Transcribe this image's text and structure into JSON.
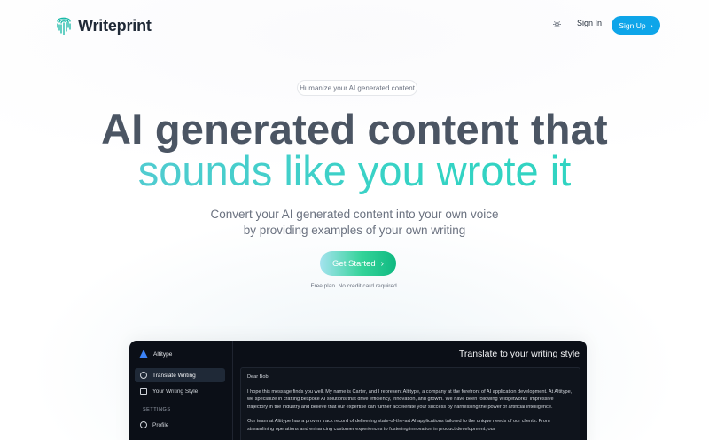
{
  "brand": {
    "name": "Writeprint"
  },
  "nav": {
    "signin_label": "Sign In",
    "signup_label": "Sign Up",
    "theme_icon": "sun-icon"
  },
  "hero": {
    "pill": "Humanize your AI generated content",
    "headline_line1": "AI generated content that",
    "headline_line2": "sounds like you wrote it",
    "subtitle_line1": "Convert your AI generated content into your own voice",
    "subtitle_line2": "by providing examples of your own writing",
    "cta_label": "Get Started",
    "note": "Free plan. No credit card required."
  },
  "app": {
    "brand": "Altitype",
    "nav_items": [
      {
        "label": "Translate Writing",
        "icon": "plus-circle-icon",
        "active": true
      },
      {
        "label": "Your Writing Style",
        "icon": "edit-icon",
        "active": false
      }
    ],
    "settings_label": "SETTINGS",
    "settings_items": [
      {
        "label": "Profile",
        "icon": "user-icon"
      }
    ],
    "title": "Translate to your writing style",
    "letter": {
      "greeting": "Dear Bob,",
      "para1": "I hope this message finds you well. My name is Carter, and I represent Altitype, a company at the forefront of AI application development. At Altitype, we specialize in crafting bespoke AI solutions that drive efficiency, innovation, and growth. We have been following Widgetworks' impressive trajectory in the industry and believe that our expertise can further accelerate your success by harnessing the power of artificial intelligence.",
      "para2": "Our team at Altitype has a proven track record of delivering state-of-the-art AI applications tailored to the unique needs of our clients. From streamlining operations and enhancing customer experiences to fostering innovation in product development, our"
    }
  },
  "colors": {
    "accent": "#0ea5e9",
    "gradient_start": "#5ec8d6",
    "gradient_end": "#2dd4bf",
    "cta_end": "#10b981",
    "app_bg": "#0b0f17"
  }
}
